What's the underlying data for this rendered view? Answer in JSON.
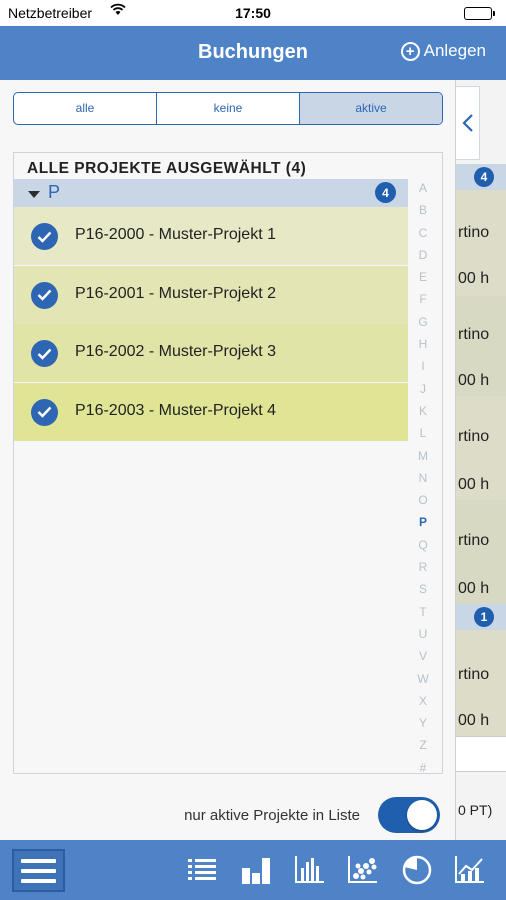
{
  "status_bar": {
    "carrier": "Netzbetreiber",
    "time": "17:50"
  },
  "nav": {
    "title": "Buchungen",
    "add_label": "Anlegen",
    "add_icon": "plus-circle-icon"
  },
  "filter": {
    "options": [
      "alle",
      "keine",
      "aktive"
    ],
    "selected": "aktive"
  },
  "list": {
    "header": "ALLE PROJEKTE AUSGEWÄHLT (4)",
    "section": {
      "letter": "P",
      "count": "4"
    },
    "items": [
      {
        "label": "P16-2000 - Muster-Projekt 1",
        "checked": true,
        "color": "#e7e9c6"
      },
      {
        "label": "P16-2001 - Muster-Projekt 2",
        "checked": true,
        "color": "#e3e6b4"
      },
      {
        "label": "P16-2002 - Muster-Projekt 3",
        "checked": true,
        "color": "#e0e4a6"
      },
      {
        "label": "P16-2003 - Muster-Projekt 4",
        "checked": true,
        "color": "#dfe594"
      }
    ],
    "index_letters": [
      "A",
      "B",
      "C",
      "D",
      "E",
      "F",
      "G",
      "H",
      "I",
      "J",
      "K",
      "L",
      "M",
      "N",
      "O",
      "P",
      "Q",
      "R",
      "S",
      "T",
      "U",
      "V",
      "W",
      "X",
      "Y",
      "Z",
      "#"
    ],
    "index_active": "P"
  },
  "toggle": {
    "label": "nur aktive Projekte in Liste",
    "on": true
  },
  "background": {
    "badge_top": "4",
    "badge_bottom": "1",
    "fragments": [
      "rtino",
      "00 h",
      "rtino",
      "00 h",
      "rtino",
      "00 h",
      "rtino",
      "00 h"
    ],
    "bottom_fragment": "0 PT)"
  },
  "tabbar": {
    "icons": [
      "menu-icon",
      "list-icon",
      "bar-chart-icon",
      "histogram-icon",
      "scatter-icon",
      "pie-chart-icon",
      "combo-chart-icon"
    ]
  },
  "colors": {
    "accent": "#4e83c8",
    "dark_accent": "#1f5fae",
    "section_bg": "#c9d6e6"
  }
}
